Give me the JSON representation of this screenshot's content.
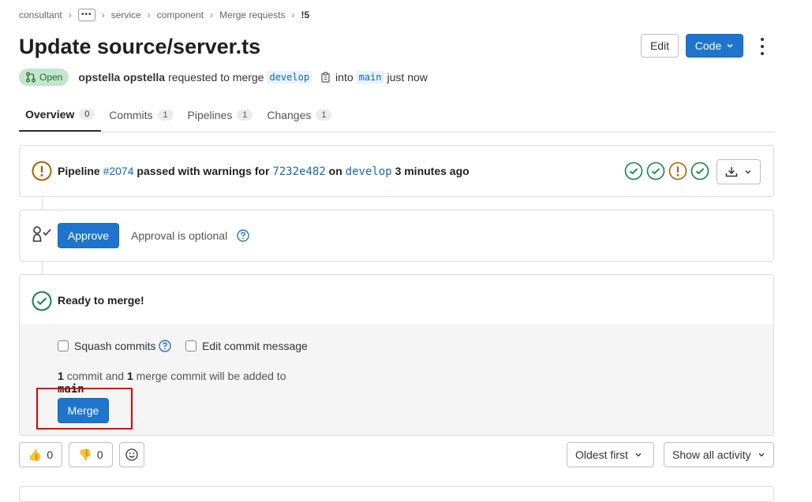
{
  "breadcrumb": {
    "items": [
      "consultant",
      "service",
      "component",
      "Merge requests"
    ],
    "more": "•••",
    "current": "!5"
  },
  "mr": {
    "title": "Update source/server.ts",
    "status": "Open",
    "author": "opstella opstella",
    "requested_text": "requested to merge",
    "source_branch": "develop",
    "into_text": "into",
    "target_branch": "main",
    "time": "just now"
  },
  "header_actions": {
    "edit_label": "Edit",
    "code_label": "Code"
  },
  "tabs": [
    {
      "label": "Overview",
      "count": "0",
      "active": true
    },
    {
      "label": "Commits",
      "count": "1"
    },
    {
      "label": "Pipelines",
      "count": "1"
    },
    {
      "label": "Changes",
      "count": "1"
    }
  ],
  "pipeline": {
    "prefix": "Pipeline",
    "id": "#2074",
    "status_text": "passed with warnings for",
    "commit": "7232e482",
    "on_text": "on",
    "branch": "develop",
    "time": "3 minutes ago",
    "stages": [
      "success",
      "success",
      "warning",
      "success"
    ]
  },
  "approval": {
    "button_label": "Approve",
    "text": "Approval is optional"
  },
  "merge": {
    "ready_text": "Ready to merge!",
    "squash_label": "Squash commits",
    "edit_msg_label": "Edit commit message",
    "summary": {
      "n1": "1",
      "t1": "commit and",
      "n2": "1",
      "t2": "merge commit will be added to",
      "branch": "main",
      "end": "."
    },
    "merge_label": "Merge"
  },
  "reactions": {
    "thumbs_up": "0",
    "thumbs_down": "0"
  },
  "sort": {
    "order": "Oldest first",
    "filter": "Show all activity"
  },
  "colors": {
    "primary": "#1f75cb",
    "success": "#108548",
    "warning": "#ab6100",
    "open_badge_bg": "#c3e6cd"
  }
}
